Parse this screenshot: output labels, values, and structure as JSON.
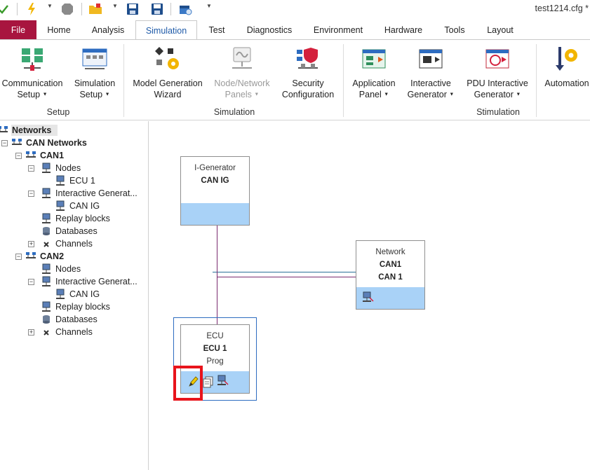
{
  "window": {
    "config_title": "test1214.cfg *"
  },
  "quick_access": [
    {
      "name": "checkmark-icon"
    },
    {
      "name": "lightning-icon"
    },
    {
      "name": "stop-icon"
    },
    {
      "name": "open-folder-icon"
    },
    {
      "name": "save-icon"
    },
    {
      "name": "save-as-icon"
    },
    {
      "name": "package-icon"
    }
  ],
  "tabs": [
    "File",
    "Home",
    "Analysis",
    "Simulation",
    "Test",
    "Diagnostics",
    "Environment",
    "Hardware",
    "Tools",
    "Layout"
  ],
  "ribbon": {
    "buttons": {
      "comm_setup": [
        "Communication",
        "Setup"
      ],
      "sim_setup": [
        "Simulation",
        "Setup"
      ],
      "model_wizard": [
        "Model Generation",
        "Wizard"
      ],
      "node_panels": [
        "Node/Network",
        "Panels"
      ],
      "security": [
        "Security",
        "Configuration"
      ],
      "app_panel": [
        "Application",
        "Panel"
      ],
      "interactive_gen": [
        "Interactive",
        "Generator"
      ],
      "pdu_gen": [
        "PDU Interactive",
        "Generator"
      ],
      "automation": [
        "Automation"
      ]
    },
    "groups": {
      "setup": "Setup",
      "simulation": "Simulation",
      "stimulation": "Stimulation"
    }
  },
  "tree": {
    "root": "Networks",
    "can_networks": "CAN Networks",
    "can1": {
      "label": "CAN1",
      "nodes": "Nodes",
      "ecu1": "ECU 1",
      "ig": "Interactive Generat...",
      "can_ig": "CAN IG",
      "replay": "Replay blocks",
      "databases": "Databases",
      "channels": "Channels"
    },
    "can2": {
      "label": "CAN2",
      "nodes": "Nodes",
      "ig": "Interactive Generat...",
      "can_ig": "CAN IG",
      "replay": "Replay blocks",
      "databases": "Databases",
      "channels": "Channels"
    }
  },
  "canvas": {
    "ig_block": {
      "type": "I-Generator",
      "name": "CAN IG"
    },
    "network_block": {
      "type": "Network",
      "name1": "CAN1",
      "name2": "CAN 1"
    },
    "ecu_block": {
      "type": "ECU",
      "name": "ECU 1",
      "prog": "Prog"
    }
  },
  "colors": {
    "accent": "#1e5aa8",
    "file_tab": "#a8153f",
    "bus_blue": "#2a6f97",
    "bus_purple": "#7a2a6f",
    "highlight": "#e8141c",
    "block_bar": "#a9d2f7"
  }
}
